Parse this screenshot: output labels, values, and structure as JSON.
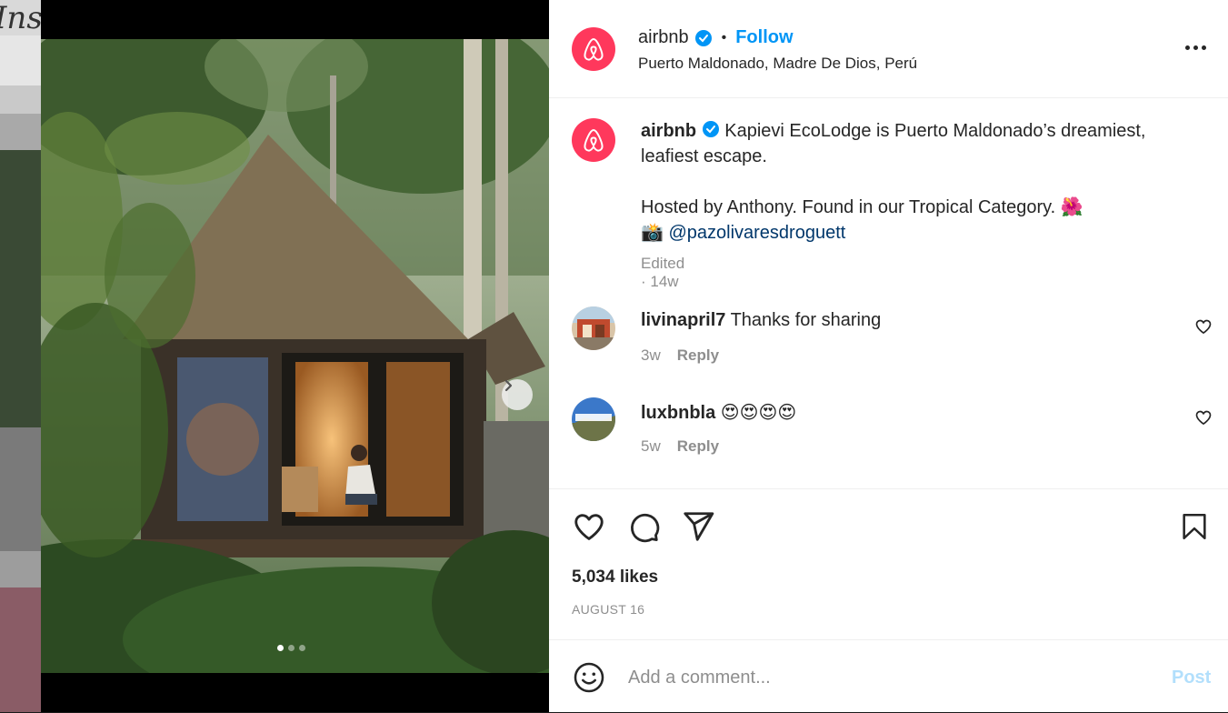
{
  "background": {
    "partial_title": "Ins"
  },
  "post": {
    "username": "airbnb",
    "follow_label": "Follow",
    "separator": "•",
    "location": "Puerto Maldonado, Madre De Dios, Perú",
    "carousel": {
      "slide_count": 3,
      "active_index": 0
    }
  },
  "caption": {
    "username": "airbnb",
    "line1": "Kapievi EcoLodge is Puerto Maldonado’s dreamiest, leafiest escape.",
    "line2": "Hosted by Anthony. Found in our Tropical Category. 🌺",
    "camera_emoji": "📸",
    "mention": "@pazolivaresdroguett",
    "meta": "Edited · 14w"
  },
  "comments": [
    {
      "username": "livinapril7",
      "text": "Thanks for sharing",
      "age": "3w",
      "reply_label": "Reply"
    },
    {
      "username": "luxbnbla",
      "text": "😍😍😍😍",
      "age": "5w",
      "reply_label": "Reply"
    }
  ],
  "engagement": {
    "likes": "5,034 likes",
    "date": "AUGUST 16"
  },
  "composer": {
    "placeholder": "Add a comment...",
    "post_label": "Post"
  },
  "colors": {
    "brand": "#ff385c",
    "link": "#0095f6",
    "mention": "#00376b",
    "muted": "#8e8e8e",
    "post_disabled": "#b2dffc"
  },
  "icons": [
    "airbnb-logo-icon",
    "verified-badge-icon",
    "more-options-icon",
    "chevron-right-icon",
    "heart-icon",
    "comment-icon",
    "share-icon",
    "bookmark-icon",
    "emoji-icon"
  ]
}
